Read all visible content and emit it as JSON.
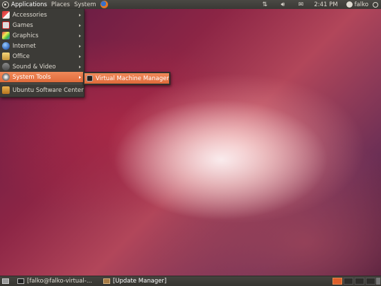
{
  "top_panel": {
    "menus": [
      "Applications",
      "Places",
      "System"
    ],
    "clock": "2:41 PM",
    "username": "falko"
  },
  "app_menu": {
    "items": [
      {
        "label": "Accessories",
        "icon": "accessories-icon",
        "has_submenu": true
      },
      {
        "label": "Games",
        "icon": "games-icon",
        "has_submenu": true
      },
      {
        "label": "Graphics",
        "icon": "graphics-icon",
        "has_submenu": true
      },
      {
        "label": "Internet",
        "icon": "internet-icon",
        "has_submenu": true
      },
      {
        "label": "Office",
        "icon": "office-icon",
        "has_submenu": true
      },
      {
        "label": "Sound & Video",
        "icon": "sound-video-icon",
        "has_submenu": true
      },
      {
        "label": "System Tools",
        "icon": "system-tools-icon",
        "has_submenu": true,
        "highlighted": true
      }
    ],
    "software_center": "Ubuntu Software Center"
  },
  "submenu": {
    "items": [
      {
        "label": "Virtual Machine Manager",
        "icon": "virtual-machine-manager-icon"
      }
    ]
  },
  "bottom_panel": {
    "tasks": [
      "[falko@falko-virtual-...",
      "[Update Manager]"
    ],
    "workspace_count": 4,
    "active_workspace": 1
  },
  "colors": {
    "highlight": "#e8703f",
    "panel": "#3c3b37",
    "text": "#dfdbd2"
  }
}
